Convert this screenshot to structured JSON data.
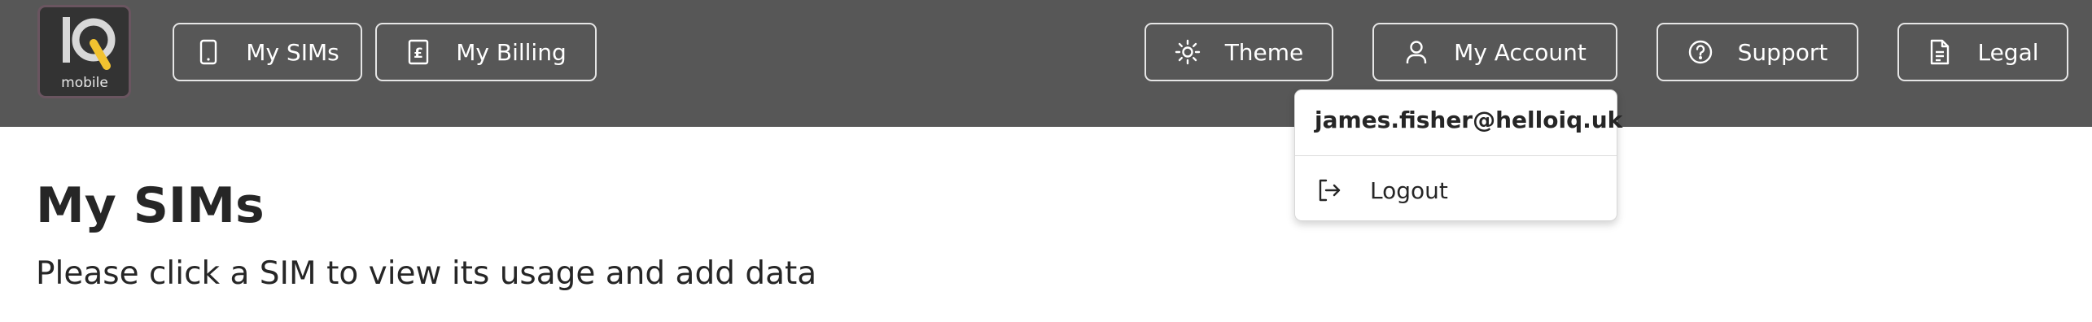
{
  "logo": {
    "brand_letters": "IQ",
    "brand_sub": "mobile"
  },
  "nav": {
    "my_sims": "My SIMs",
    "my_billing": "My Billing",
    "theme": "Theme",
    "my_account": "My Account",
    "support": "Support",
    "legal": "Legal"
  },
  "account_menu": {
    "email": "james.fisher@helloiq.uk",
    "logout": "Logout"
  },
  "main": {
    "title": "My SIMs",
    "subtitle": "Please click a SIM to view its usage and add data"
  },
  "colors": {
    "navbar_bg": "#575757",
    "logo_accent": "#f2c230",
    "text_dark": "#262626"
  },
  "icons": {
    "my_sims": "phone-icon",
    "my_billing": "receipt-pound-icon",
    "theme": "sun-icon",
    "my_account": "user-icon",
    "support": "help-circle-icon",
    "legal": "document-icon",
    "logout": "logout-icon"
  }
}
